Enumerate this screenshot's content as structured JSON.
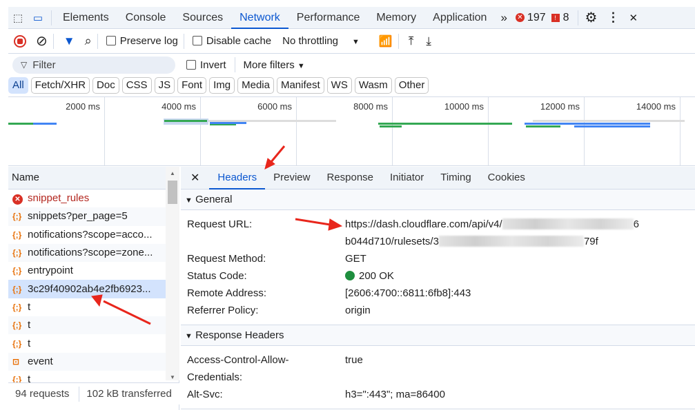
{
  "tabs": [
    "Elements",
    "Console",
    "Sources",
    "Network",
    "Performance",
    "Memory",
    "Application"
  ],
  "active_tab": "Network",
  "errors_count": "197",
  "warnings_count": "8",
  "toolbar": {
    "preserve_log": "Preserve log",
    "disable_cache": "Disable cache",
    "throttling": "No throttling"
  },
  "filter": {
    "placeholder": "Filter",
    "invert": "Invert",
    "more_filters": "More filters"
  },
  "type_filters": [
    "All",
    "Fetch/XHR",
    "Doc",
    "CSS",
    "JS",
    "Font",
    "Img",
    "Media",
    "Manifest",
    "WS",
    "Wasm",
    "Other"
  ],
  "timeline": {
    "ticks": [
      "2000 ms",
      "4000 ms",
      "6000 ms",
      "8000 ms",
      "10000 ms",
      "12000 ms",
      "14000 ms"
    ]
  },
  "requests": {
    "header": "Name",
    "rows": [
      {
        "name": "snippet_rules",
        "type": "error"
      },
      {
        "name": "snippets?per_page=5",
        "type": "fetch"
      },
      {
        "name": "notifications?scope=acco...",
        "type": "fetch"
      },
      {
        "name": "notifications?scope=zone...",
        "type": "fetch"
      },
      {
        "name": "entrypoint",
        "type": "fetch"
      },
      {
        "name": "3c29f40902ab4e2fb6923...",
        "type": "fetch",
        "selected": true
      },
      {
        "name": "t",
        "type": "fetch"
      },
      {
        "name": "t",
        "type": "fetch"
      },
      {
        "name": "t",
        "type": "fetch"
      },
      {
        "name": "event",
        "type": "doc"
      },
      {
        "name": "t",
        "type": "fetch"
      }
    ]
  },
  "footer": {
    "requests": "94 requests",
    "transferred": "102 kB transferred"
  },
  "details": {
    "tabs": [
      "Headers",
      "Preview",
      "Response",
      "Initiator",
      "Timing",
      "Cookies"
    ],
    "active_tab": "Headers",
    "general_title": "General",
    "url_label": "Request URL:",
    "url_part1": "https://dash.cloudflare.com/api/v4/",
    "url_part1_end": "6",
    "url_part2": "b044d710/rulesets/3",
    "url_part2_end": "79f",
    "method_label": "Request Method:",
    "method": "GET",
    "status_label": "Status Code:",
    "status": "200 OK",
    "status_color": "#1e8e3e",
    "remote_label": "Remote Address:",
    "remote": "[2606:4700::6811:6fb8]:443",
    "referrer_label": "Referrer Policy:",
    "referrer": "origin",
    "response_title": "Response Headers",
    "acac_label": "Access-Control-Allow-Credentials:",
    "acac": "true",
    "altsvc_label": "Alt-Svc:",
    "altsvc": "h3=\":443\"; ma=86400"
  },
  "colors": {
    "accent": "#0b57d0",
    "error": "#d93025",
    "annotation": "#e8261c"
  }
}
